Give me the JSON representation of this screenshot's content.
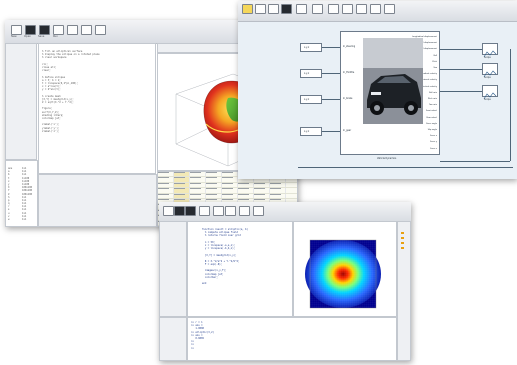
{
  "window1": {
    "toolbar_buttons": [
      "New",
      "Open",
      "Save",
      "Run",
      "",
      "",
      ""
    ],
    "editor_lines": [
      "% fill an elliptical surface",
      "% display the ellipse on a rotated plane",
      "% clear workspace",
      "",
      "clc;",
      "close all;",
      "clear;",
      "",
      "% define ellipse",
      "a = 3; b = 2;",
      "t = linspace(0,2*pi,100);",
      "x = a*cos(t);",
      "y = b*sin(t);",
      "",
      "% create mesh",
      "[X,Y] = meshgrid(x,y);",
      "Z = sqrt(X.^2 + Y.^2);",
      "",
      "figure;",
      "surf(X,Y,Z);",
      "shading interp;",
      "colormap jet;",
      "",
      "xlabel('x');",
      "ylabel('y');",
      "zlabel('z');"
    ],
    "workspace_rows": [
      [
        "ans",
        "1x1"
      ],
      [
        "a",
        "1x1"
      ],
      [
        "b",
        "1x1"
      ],
      [
        "t",
        "1x100"
      ],
      [
        "x",
        "1x100"
      ],
      [
        "y",
        "1x100"
      ],
      [
        "X",
        "100x100"
      ],
      [
        "Y",
        "100x100"
      ],
      [
        "Z",
        "100x100"
      ],
      [
        "h",
        "1x1"
      ],
      [
        "p",
        "1x1"
      ],
      [
        "q",
        "1x1"
      ],
      [
        "r",
        "1x1"
      ],
      [
        "s",
        "1x1"
      ],
      [
        "u",
        "1x1"
      ],
      [
        "v",
        "1x1"
      ],
      [
        "w",
        "1x1"
      ]
    ],
    "table_rows": 12,
    "table_cols": 8
  },
  "window2": {
    "toolbar_buttons": [
      "",
      "",
      "",
      "",
      "",
      "",
      "",
      "",
      "",
      "",
      ""
    ],
    "left_blocks": [
      "x,y,z",
      "x,y,z",
      "x,y,z",
      "x,y,z"
    ],
    "inputs": [
      "In_steering",
      "In_throttle",
      "In_brake",
      "In_gear"
    ],
    "outputs": [
      "Longitudinal displacement",
      "Lateral displacement",
      "Vertical displacement",
      "Roll",
      "Pitch",
      "Yaw",
      "Longitudinal velocity",
      "Lateral velocity",
      "Vertical velocity",
      "Roll rate",
      "Pitch rate",
      "Yaw rate",
      "Front wheel",
      "Rear wheel",
      "Steer angle",
      "Slip angle",
      "Force x",
      "Force y",
      "Force z"
    ],
    "block_label": "Vehicle Dynamics",
    "scopes": [
      "Scope",
      "Scope",
      "Scope"
    ]
  },
  "window3": {
    "toolbar_buttons": [
      "",
      "",
      "",
      "",
      "",
      "",
      "",
      ""
    ],
    "editor_lines": [
      "function result = elliptic(a, b)",
      "  % compute ellipse field",
      "  % returns field over grid",
      "",
      "  n = 50;",
      "  x = linspace(-a,a,n);",
      "  y = linspace(-b,b,n);",
      "",
      "  [X,Y] = meshgrid(x,y);",
      "",
      "  R = X.^2/a^2 + Y.^2/b^2;",
      "  F = exp(-R);",
      "",
      "  imagesc(x,y,F);",
      "  colormap jet;",
      "  colorbar;",
      "",
      "end"
    ],
    "console_lines": [
      ">> r = 1",
      ">> ans =",
      "   1.0000",
      ">> elliptic(3,2)",
      ">> ans =",
      "   0.6065",
      ">> ",
      ">> ",
      ">> "
    ]
  }
}
